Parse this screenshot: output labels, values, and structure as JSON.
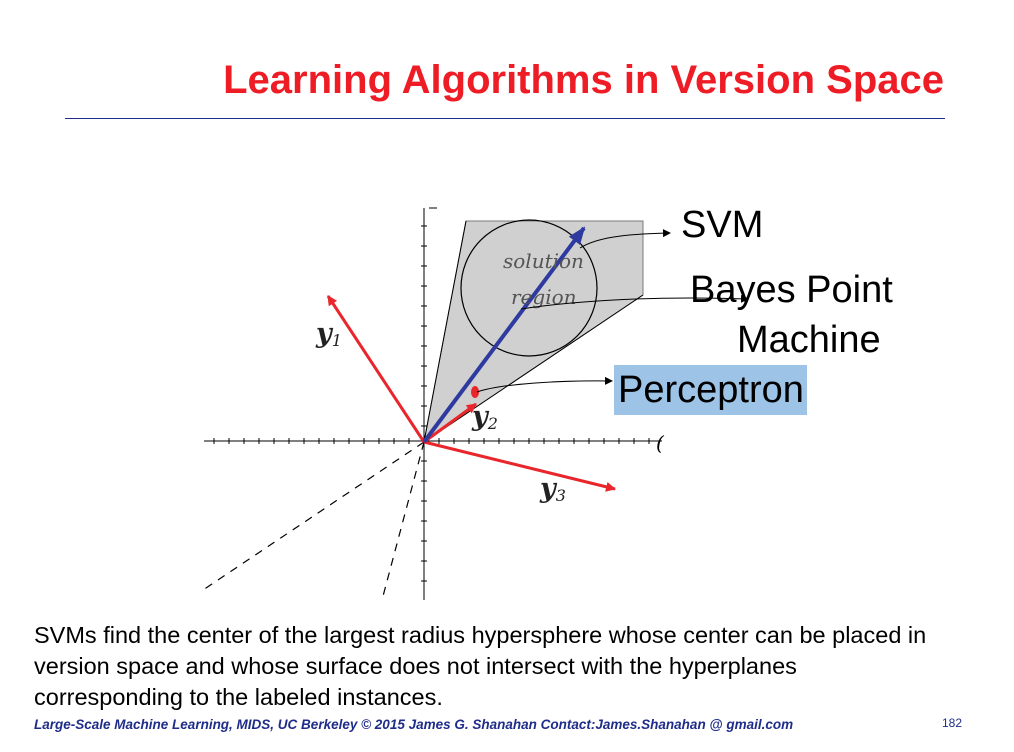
{
  "slide": {
    "title": "Learning Algorithms in Version Space",
    "body_text": "SVMs find the center of the largest radius hypersphere whose center can be placed in version space and whose surface does not intersect with the hyperplanes corresponding to the labeled instances.",
    "footer": "Large-Scale Machine Learning, MIDS, UC Berkeley ©  2015 James G. Shanahan   Contact:James.Shanahan @ gmail.com",
    "page_number": "182"
  },
  "diagram": {
    "region_label_line1": "solution",
    "region_label_line2": "region",
    "vector_y1": "y",
    "vector_y1_sub": "1",
    "vector_y2": "y",
    "vector_y2_sub": "2",
    "vector_y3": "y",
    "vector_y3_sub": "3",
    "axis_end_mark": "(",
    "callout_svm": "SVM",
    "callout_bpm_line1": "Bayes Point",
    "callout_bpm_line2": "Machine",
    "callout_perceptron": "Perceptron"
  },
  "colors": {
    "title": "#ee1c25",
    "rule_and_footer": "#1f2d8a",
    "hyperplane_vectors": "#e8262b",
    "svm_vector": "#2e3a9f",
    "solution_region": "#d0d0d0",
    "perceptron_highlight": "#9dc3e6"
  }
}
